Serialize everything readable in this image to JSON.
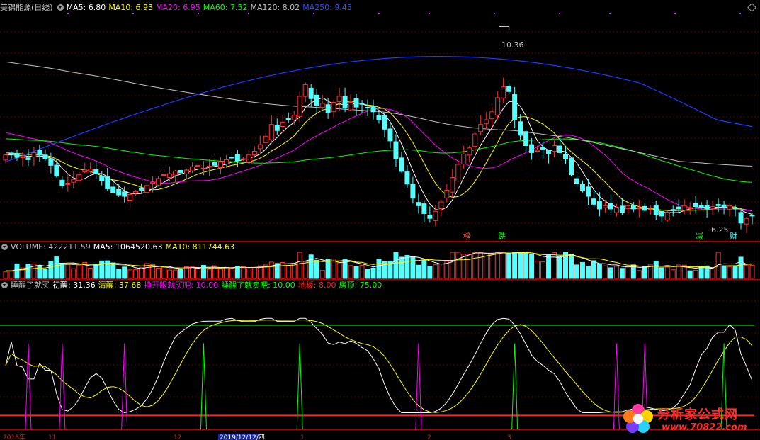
{
  "colors": {
    "bg": "#000000",
    "up": "#ff3232",
    "down": "#54ffff",
    "grid": "#5a0000",
    "ma5": "#ffffff",
    "ma10": "#ffff00",
    "ma20": "#ff00ff",
    "ma60": "#00ff00",
    "ma120": "#c0c0c0",
    "ma250": "#1a3cff"
  },
  "price_header": {
    "title": "美锦能源(日线)",
    "items": [
      {
        "label": "MA5: 6.80",
        "color": "#ffffff"
      },
      {
        "label": "MA10: 6.93",
        "color": "#ffff00"
      },
      {
        "label": "MA20: 6.95",
        "color": "#ff00ff"
      },
      {
        "label": "MA60: 7.52",
        "color": "#00ff00"
      },
      {
        "label": "MA120: 8.02",
        "color": "#c0c0c0"
      },
      {
        "label": "MA250: 9.45",
        "color": "#3050ff"
      }
    ]
  },
  "volume_header": {
    "items": [
      {
        "label": "VOLUME: 422211.59",
        "color": "#c0c0c0"
      },
      {
        "label": "MA5: 1064520.63",
        "color": "#ffffff"
      },
      {
        "label": "MA10: 811744.63",
        "color": "#ffff00"
      }
    ]
  },
  "indicator_header": {
    "items": [
      {
        "label": "睡醒了就买",
        "color": "#c0c0c0"
      },
      {
        "label": "初醒: 31.36",
        "color": "#ffffff"
      },
      {
        "label": "清醒: 37.68",
        "color": "#ffff00"
      },
      {
        "label": "挣开眼就买吧: 10.00",
        "color": "#ff00ff"
      },
      {
        "label": "睡醒了就卖吧: 10.00",
        "color": "#00ff00"
      },
      {
        "label": "地板: 8.00",
        "color": "#ff2020"
      },
      {
        "label": "房顶: 75.00",
        "color": "#00ff00"
      }
    ]
  },
  "annotations": {
    "high_label": "10.36",
    "low_label": "6.25",
    "markers": [
      {
        "text": "榜",
        "color": "#ff5050"
      },
      {
        "text": "跌",
        "color": "#00ff00"
      },
      {
        "text": "减",
        "color": "#00ff00"
      },
      {
        "text": "财",
        "color": "#54ffff"
      }
    ]
  },
  "axis_dates": [
    "2018年",
    "11",
    "12",
    "2019/12/12/四",
    "1",
    "2",
    "3"
  ],
  "watermark": {
    "title": "分析家公式网",
    "url": "www.70822.com"
  },
  "chart_data": [
    {
      "type": "candlestick",
      "title": "美锦能源(日线)",
      "series_names": [
        "MA5",
        "MA10",
        "MA20",
        "MA60",
        "MA120",
        "MA250"
      ],
      "last_values": {
        "MA5": 6.8,
        "MA10": 6.93,
        "MA20": 6.95,
        "MA60": 7.52,
        "MA120": 8.02,
        "MA250": 9.45
      },
      "high": 10.36,
      "low": 6.25,
      "close": [
        7.7,
        7.72,
        7.65,
        7.68,
        7.6,
        7.75,
        7.7,
        7.62,
        7.48,
        7.25,
        7.05,
        7.1,
        7.18,
        7.28,
        7.38,
        7.4,
        7.3,
        7.15,
        6.98,
        6.9,
        6.85,
        6.82,
        6.86,
        6.92,
        6.95,
        7.05,
        7.12,
        7.2,
        7.28,
        7.3,
        7.36,
        7.32,
        7.38,
        7.45,
        7.48,
        7.42,
        7.46,
        7.48,
        7.55,
        7.6,
        7.65,
        7.58,
        7.62,
        7.7,
        7.78,
        7.92,
        8.1,
        8.35,
        8.22,
        8.4,
        8.45,
        8.55,
        8.95,
        9.2,
        8.9,
        8.75,
        8.8,
        8.6,
        8.82,
        8.95,
        8.7,
        8.82,
        8.72,
        8.78,
        8.7,
        8.62,
        8.45,
        8.25,
        8.0,
        7.62,
        7.35,
        7.08,
        6.78,
        6.62,
        6.45,
        6.35,
        6.5,
        6.7,
        6.95,
        7.22,
        7.5,
        7.72,
        7.85,
        8.15,
        8.35,
        8.45,
        8.62,
        8.92,
        9.15,
        9.05,
        8.45,
        8.12,
        7.9,
        7.75,
        7.8,
        7.82,
        7.72,
        7.9,
        7.75,
        7.62,
        7.28,
        7.1,
        6.95,
        6.82,
        6.65,
        6.55,
        6.62,
        6.55,
        6.58,
        6.48,
        6.62,
        6.55,
        6.58,
        6.52,
        6.55,
        6.42,
        6.4,
        6.48,
        6.52,
        6.55,
        6.62,
        6.58,
        6.6,
        6.58,
        6.55,
        6.6,
        6.62,
        6.58,
        6.62,
        6.55,
        6.25,
        6.35,
        6.4
      ]
    },
    {
      "type": "bar",
      "title": "VOLUME",
      "series_names": [
        "VOLUME",
        "MA5",
        "MA10"
      ],
      "last_values": {
        "VOLUME": 422211.59,
        "MA5": 1064520.63,
        "MA10": 811744.63
      }
    },
    {
      "type": "line",
      "title": "睡醒了就买",
      "series_names": [
        "初醒",
        "清醒",
        "挣开眼就买吧",
        "睡醒了就卖吧",
        "地板",
        "房顶"
      ],
      "last_values": {
        "初醒": 31.36,
        "清醒": 37.68,
        "挣开眼就买吧": 10.0,
        "睡醒了就卖吧": 10.0,
        "地板": 8.0,
        "房顶": 75.0
      },
      "floor": 8.0,
      "roof": 75.0
    }
  ]
}
